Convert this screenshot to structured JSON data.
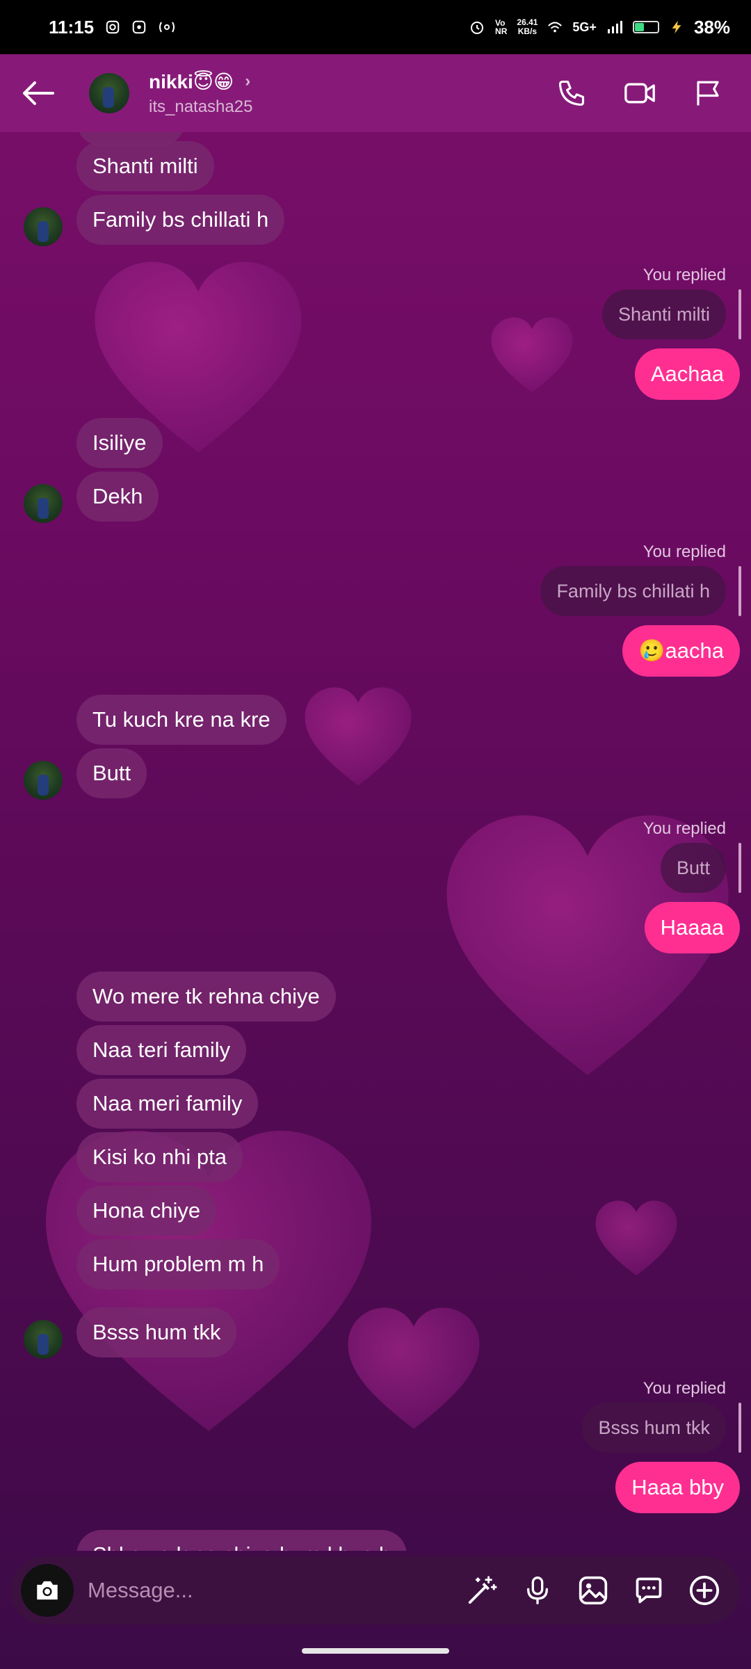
{
  "status_bar": {
    "time": "11:15",
    "net_speed_top": "26.41",
    "net_speed_bottom": "KB/s",
    "volte_top": "Vo",
    "volte_bottom": "NR",
    "network": "5G+",
    "battery_percent": "38%",
    "battery_level": 0.38
  },
  "header": {
    "name": "nikki😇😁",
    "username": "its_natasha25",
    "chevron": "›"
  },
  "messages": {
    "m1": "Shanti milti",
    "m2": "Family bs chillati h",
    "reply1_label": "You replied",
    "reply1_quote": "Shanti milti",
    "reply1_text": "Aachaa",
    "m3": "Isiliye",
    "m4": "Dekh",
    "reply2_label": "You replied",
    "reply2_quote": "Family bs chillati h",
    "reply2_text": "🥲aacha",
    "m5": "Tu kuch kre na kre",
    "m6": "Butt",
    "reply3_label": "You replied",
    "reply3_quote": "Butt",
    "reply3_text": "Haaaa",
    "m7": "Wo mere tk rehna chiye",
    "m8": "Naa teri family",
    "m9": "Naa meri family",
    "m10": "Kisi ko nhi pta",
    "m11": "Hona chiye",
    "m12": "Hum problem m h",
    "m13": "Bsss hum tkk",
    "reply4_label": "You replied",
    "reply4_quote": "Bsss hum tkk",
    "reply4_text": "Haaa bby",
    "m14": "Sbko ye lgna chiye hum khus h"
  },
  "composer": {
    "placeholder": "Message..."
  },
  "icons": {
    "back": "back-arrow-icon",
    "call": "phone-icon",
    "video": "video-icon",
    "flag": "flag-icon",
    "camera": "camera-icon",
    "effects": "magic-wand-icon",
    "mic": "microphone-icon",
    "gallery": "image-icon",
    "chat": "chat-bubble-icon",
    "add": "plus-circle-icon"
  },
  "colors": {
    "outgoing_bubble": "#ff2f92",
    "header_bg": "#871a79",
    "background_top": "#7a0f6a",
    "background_bottom": "#3c0b47"
  }
}
